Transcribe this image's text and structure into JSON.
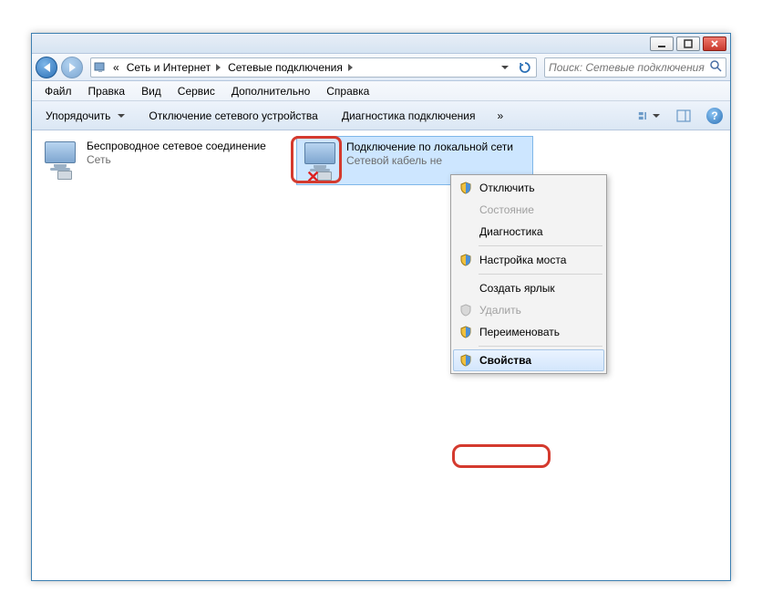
{
  "titlebar": {
    "min": "",
    "max": "",
    "close": ""
  },
  "breadcrumb": {
    "level1": "Сеть и Интернет",
    "level2": "Сетевые подключения"
  },
  "search": {
    "placeholder": "Поиск: Сетевые подключения"
  },
  "menubar": {
    "file": "Файл",
    "edit": "Правка",
    "view": "Вид",
    "tools": "Сервис",
    "extra": "Дополнительно",
    "help": "Справка"
  },
  "toolbar": {
    "organize": "Упорядочить",
    "disable": "Отключение сетевого устройства",
    "diagnose": "Диагностика подключения"
  },
  "connections": {
    "wireless": {
      "title": "Беспроводное сетевое соединение",
      "line2": "Сеть"
    },
    "lan": {
      "title": "Подключение по локальной сети",
      "line2": "Сетевой кабель не"
    }
  },
  "context_menu": {
    "disable": "Отключить",
    "status": "Состояние",
    "diagnose": "Диагностика",
    "bridge": "Настройка моста",
    "shortcut": "Создать ярлык",
    "delete": "Удалить",
    "rename": "Переименовать",
    "properties": "Свойства"
  }
}
